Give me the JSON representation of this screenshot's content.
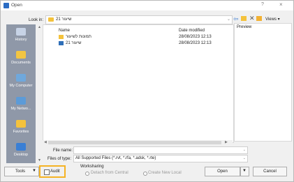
{
  "window": {
    "title": "Open",
    "help_symbol": "?",
    "close_symbol": "×",
    "accent_color": "#2b6cc4"
  },
  "lookin": {
    "label": "Look in:",
    "value": "21 שיעור"
  },
  "toolbar": {
    "views_label": "Views"
  },
  "places": [
    {
      "label": "History",
      "icon": "history-icon"
    },
    {
      "label": "Documents",
      "icon": "documents-icon"
    },
    {
      "label": "My Computer",
      "icon": "my-computer-icon"
    },
    {
      "label": "My Netwo...",
      "icon": "network-icon"
    },
    {
      "label": "Favorites",
      "icon": "favorites-icon"
    },
    {
      "label": "Desktop",
      "icon": "desktop-icon"
    }
  ],
  "file_list": {
    "columns": {
      "name": "Name",
      "date": "Date modified"
    },
    "rows": [
      {
        "name": "תמונות לשיעור",
        "date": "28/08/2023 12:13",
        "icon": "folder-icon"
      },
      {
        "name": "שיעור 21",
        "date": "28/08/2023 12:13",
        "icon": "revit-file-icon"
      }
    ]
  },
  "preview": {
    "label": "Preview"
  },
  "filename": {
    "label": "File name:",
    "value": ""
  },
  "filetype": {
    "label": "Files of type:",
    "value": "All Supported Files  (*.rvt, *.rfa, *.adsk, *.rte)"
  },
  "bottom": {
    "tools_label": "Tools",
    "audit_label": "Audit",
    "worksharing_label": "Worksharing",
    "detach_label": "Detach from Central",
    "create_local_label": "Create New Local",
    "open_label": "Open",
    "cancel_label": "Cancel",
    "highlight_color": "#f5b324"
  }
}
